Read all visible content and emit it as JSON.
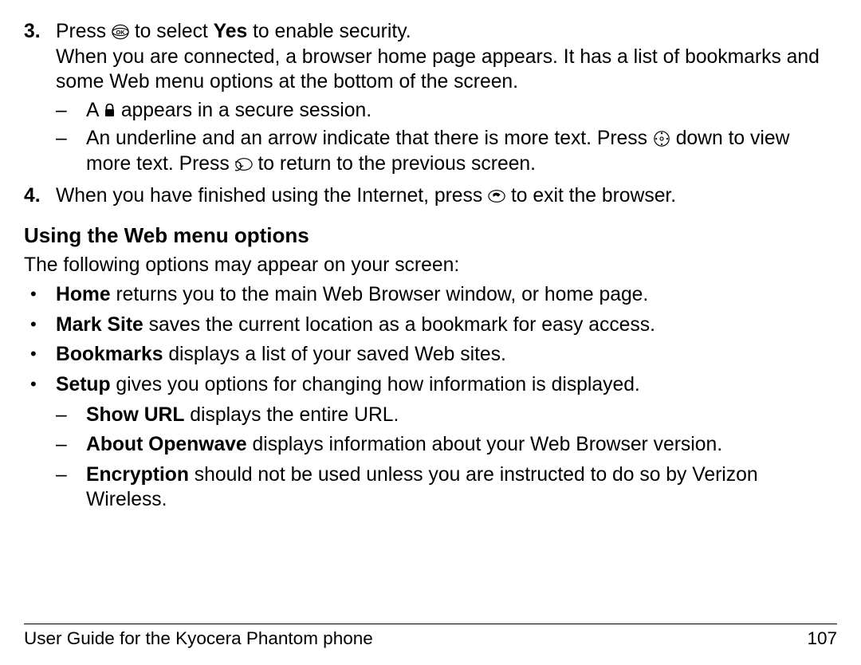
{
  "step3": {
    "num": "3.",
    "a": "Press",
    "b": "to select",
    "yes": "Yes",
    "c": "to enable security.",
    "para": "When you are connected, a browser home page appears. It has a list of bookmarks and some Web menu options at the bottom of the screen.",
    "sub1a": "A",
    "sub1b": "appears in a secure session.",
    "sub2a": "An underline and an arrow indicate that there is more text. Press",
    "sub2b": "down to view more text. Press",
    "sub2c": "to return to the previous screen."
  },
  "step4": {
    "num": "4.",
    "a": "When you have finished using the Internet, press",
    "b": "to exit the browser."
  },
  "heading": "Using the Web menu options",
  "intro": "The following options may appear on your screen:",
  "bullets": {
    "home": {
      "k": "Home",
      "t": " returns you to the main Web Browser window, or home page."
    },
    "mark": {
      "k": "Mark Site",
      "t": " saves the current location as a bookmark for easy access."
    },
    "bookmarks": {
      "k": "Bookmarks",
      "t": " displays a list of your saved Web sites."
    },
    "setup": {
      "k": "Setup",
      "t": " gives you options for changing how information is displayed."
    },
    "showurl": {
      "k": "Show URL",
      "t": " displays the entire URL."
    },
    "openwave": {
      "k": "About Openwave",
      "t": " displays information about your Web Browser version."
    },
    "encryption": {
      "k": "Encryption",
      "t": " should not be used unless you are instructed to do so by Verizon Wireless."
    }
  },
  "footer": {
    "left": "User Guide for the Kyocera Phantom phone",
    "right": "107"
  }
}
